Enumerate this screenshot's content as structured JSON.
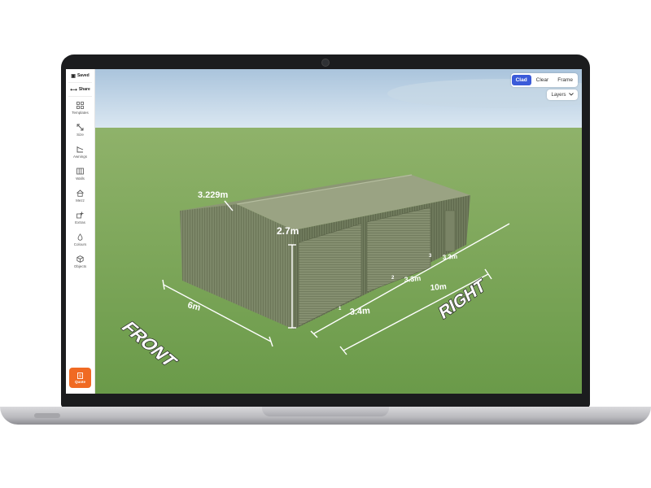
{
  "sidebar": {
    "saved_label": "Saved",
    "share_label": "Share",
    "items": [
      {
        "label": "Templates",
        "icon": "grid-icon"
      },
      {
        "label": "Size",
        "icon": "resize-icon"
      },
      {
        "label": "Awnings",
        "icon": "awning-icon"
      },
      {
        "label": "Walls",
        "icon": "walls-icon"
      },
      {
        "label": "Mezz",
        "icon": "mezz-icon"
      },
      {
        "label": "Extras",
        "icon": "extras-icon"
      },
      {
        "label": "Colours",
        "icon": "droplet-icon"
      },
      {
        "label": "Objects",
        "icon": "cube-icon"
      }
    ],
    "quote_label": "Quote"
  },
  "view_toggle": {
    "options": [
      "Clad",
      "Clear",
      "Frame"
    ],
    "selected": "Clad"
  },
  "layers_label": "Layers",
  "dimensions": {
    "span": "3.229m",
    "height": "2.7m",
    "front_width": "6m",
    "bay_a": "3.4m",
    "bay_b": "3.3m",
    "bay_c": "3.3m",
    "length": "10m",
    "bay_numbers": [
      "1",
      "2",
      "3"
    ]
  },
  "ground_labels": {
    "front": "FRONT",
    "right": "RIGHT"
  },
  "colors": {
    "accent": "#3b5bd9",
    "quote": "#f06a23",
    "shed": "#7f8a6b",
    "grass": "#7aa25a"
  }
}
